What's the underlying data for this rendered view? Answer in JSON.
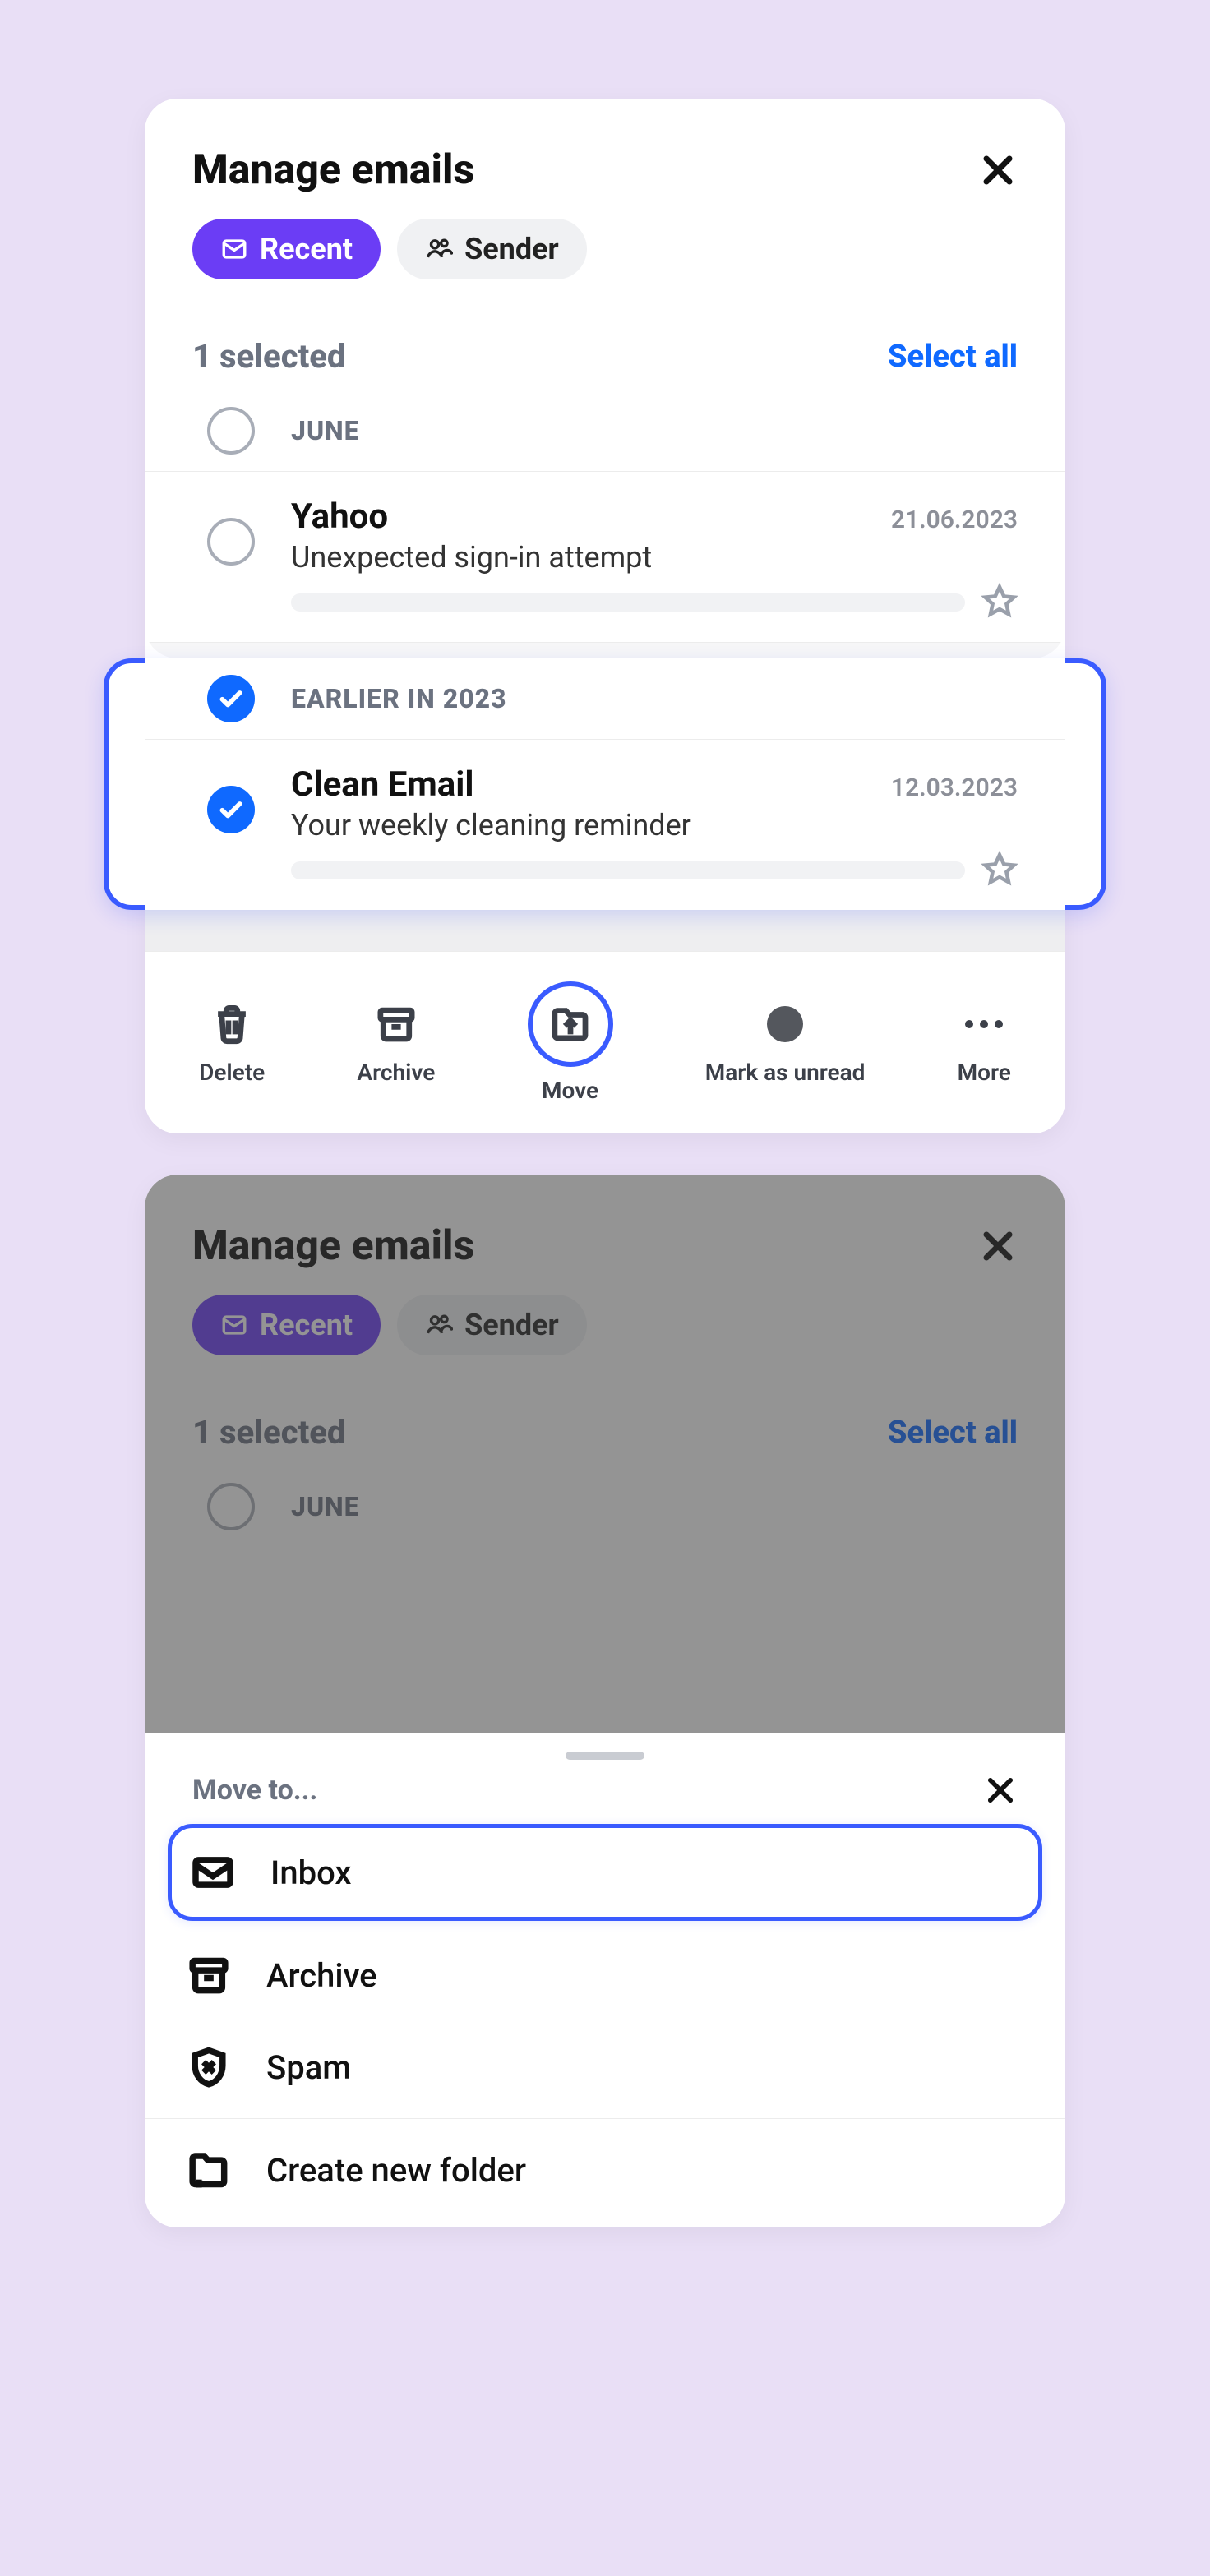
{
  "screen1": {
    "title": "Manage emails",
    "pills": {
      "recent": "Recent",
      "sender": "Sender"
    },
    "selected_count_label": "1 selected",
    "select_all": "Select all",
    "month1": "JUNE",
    "mail1": {
      "sender": "Yahoo",
      "date": "21.06.2023",
      "subject": "Unexpected sign-in attempt"
    },
    "month2": "EARLIER IN 2023",
    "mail2": {
      "sender": "Clean Email",
      "date": "12.03.2023",
      "subject": "Your weekly cleaning reminder"
    },
    "toolbar": {
      "delete": "Delete",
      "archive": "Archive",
      "move": "Move",
      "unread": "Mark as unread",
      "more": "More"
    }
  },
  "screen2": {
    "title": "Manage emails",
    "pills": {
      "recent": "Recent",
      "sender": "Sender"
    },
    "selected_count_label": "1 selected",
    "select_all": "Select all",
    "month1": "JUNE",
    "sheet_title": "Move to...",
    "dest": {
      "inbox": "Inbox",
      "archive": "Archive",
      "spam": "Spam",
      "create": "Create new folder"
    }
  }
}
